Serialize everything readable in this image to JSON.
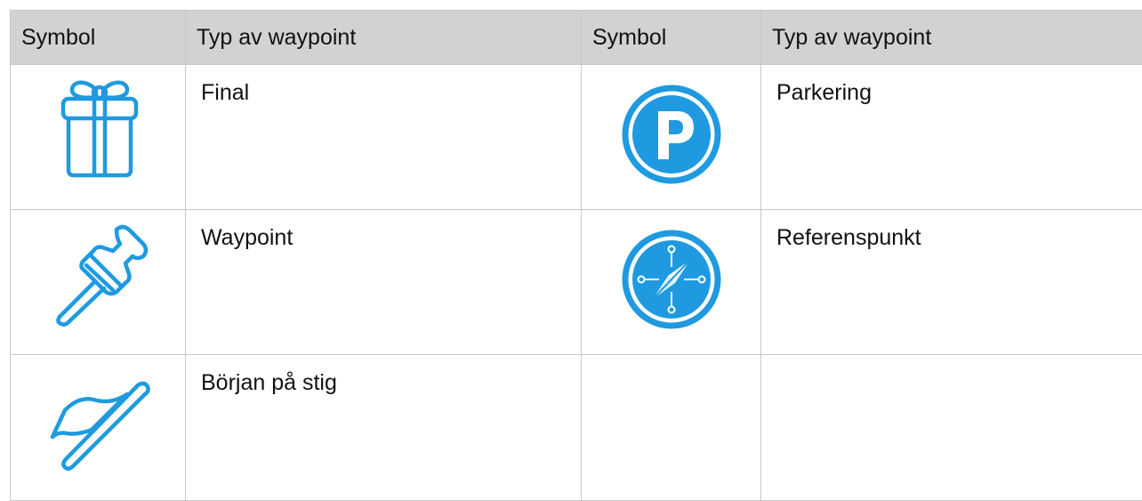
{
  "table": {
    "headers": [
      "Symbol",
      "Typ av waypoint",
      "Symbol",
      "Typ av waypoint"
    ],
    "rows": [
      {
        "left": {
          "icon": "gift-icon",
          "label": "Final"
        },
        "right": {
          "icon": "parking-icon",
          "label": "Parkering"
        }
      },
      {
        "left": {
          "icon": "pushpin-icon",
          "label": "Waypoint"
        },
        "right": {
          "icon": "compass-icon",
          "label": "Referenspunkt"
        }
      },
      {
        "left": {
          "icon": "flag-icon",
          "label": "Början på stig"
        },
        "right": {
          "icon": "",
          "label": ""
        }
      }
    ]
  },
  "colors": {
    "icon_blue": "#1f9ae0",
    "header_bg": "#d2d2d2",
    "grid_line": "#c8c8c8",
    "text": "#111111"
  }
}
